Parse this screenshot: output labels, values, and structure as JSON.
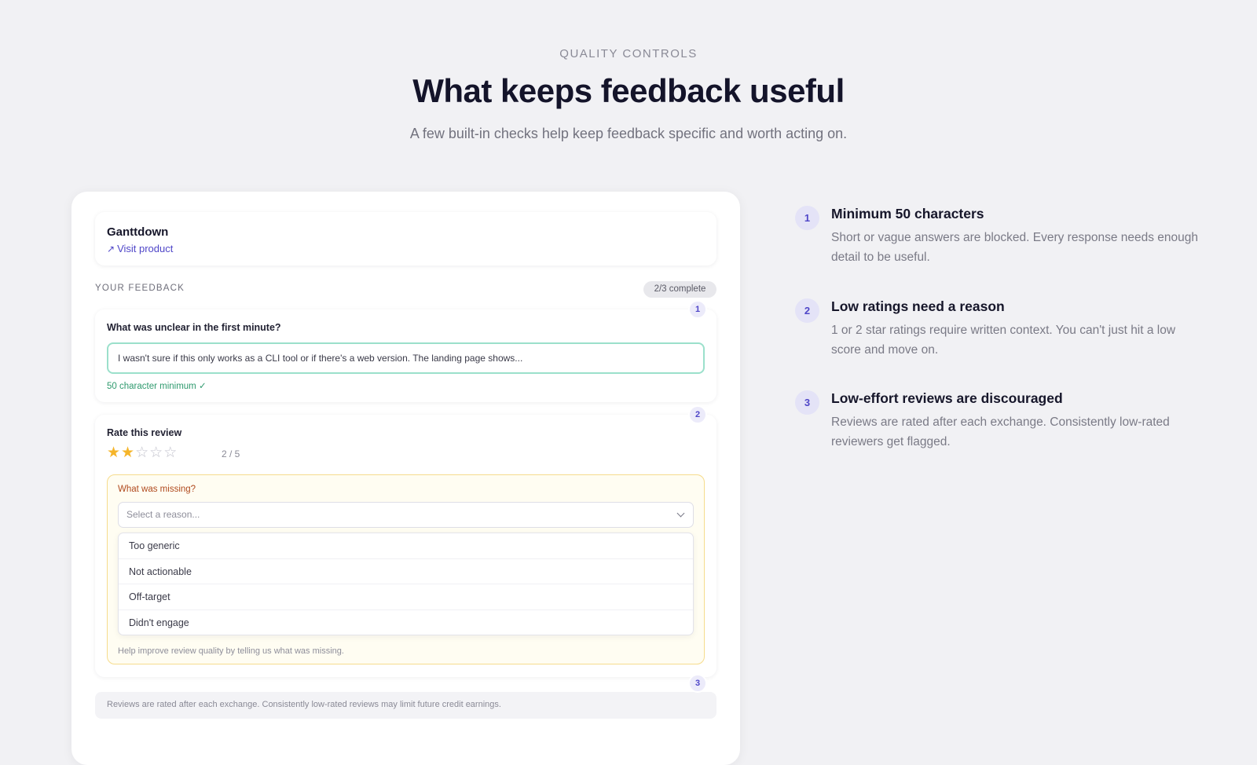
{
  "header": {
    "eyebrow": "QUALITY CONTROLS",
    "title": "What keeps feedback useful",
    "subtitle": "A few built-in checks help keep feedback specific and worth acting on."
  },
  "card": {
    "product": {
      "name": "Ganttdown",
      "visit_label": "Visit product",
      "visit_icon": "arrow-up-right-icon"
    },
    "section_label": "YOUR FEEDBACK",
    "progress": "2/3 complete",
    "question1": {
      "step": "1",
      "label": "What was unclear in the first minute?",
      "answer": "I wasn't sure if this only works as a CLI tool or if there's a web version. The landing page shows...",
      "validation": "50 character minimum ✓"
    },
    "question2": {
      "step": "2",
      "label": "Rate this review",
      "rating": 2,
      "rating_max": 5,
      "rating_text": "2 / 5",
      "missing_label": "What was missing?",
      "select_placeholder": "Select a reason...",
      "options": [
        "Too generic",
        "Not actionable",
        "Off-target",
        "Didn't engage"
      ],
      "help_text": "Help improve review quality by telling us what was missing."
    },
    "notice": {
      "step": "3",
      "text": "Reviews are rated after each exchange. Consistently low-rated reviews may limit future credit earnings."
    }
  },
  "features": [
    {
      "num": "1",
      "title": "Minimum 50 characters",
      "desc": "Short or vague answers are blocked. Every response needs enough detail to be useful."
    },
    {
      "num": "2",
      "title": "Low ratings need a reason",
      "desc": "1 or 2 star ratings require written context. You can't just hit a low score and move on."
    },
    {
      "num": "3",
      "title": "Low-effort reviews are discouraged",
      "desc": "Reviews are rated after each exchange. Consistently low-rated reviewers get flagged."
    }
  ],
  "colors": {
    "accent": "#4f46c8",
    "star": "#f5b52a",
    "success": "#2f9a6e",
    "warning_border": "#f6dc8d"
  }
}
